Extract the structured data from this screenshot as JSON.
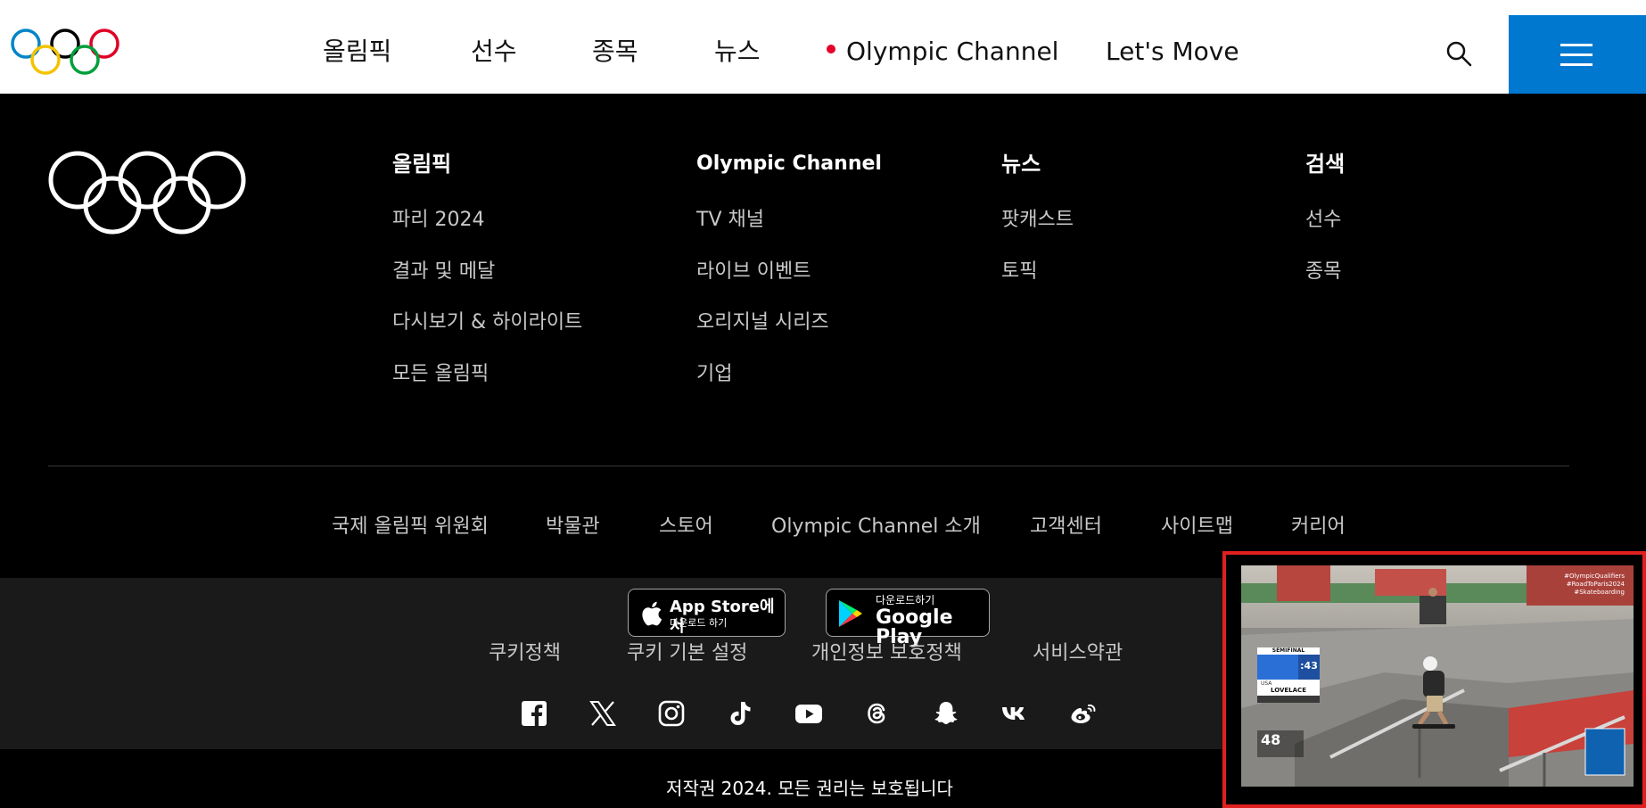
{
  "header": {
    "nav": [
      {
        "label": "올림픽"
      },
      {
        "label": "선수"
      },
      {
        "label": "종목"
      },
      {
        "label": "뉴스"
      },
      {
        "label": "Olympic Channel",
        "live": true
      },
      {
        "label": "Let's Move"
      }
    ],
    "search_icon": "search-icon",
    "menu_icon": "hamburger-menu-icon"
  },
  "footer": {
    "columns": [
      {
        "title": "올림픽",
        "links": [
          "파리 2024",
          "결과 및 메달",
          "다시보기 & 하이라이트",
          "모든 올림픽"
        ]
      },
      {
        "title": "Olympic Channel",
        "links": [
          "TV 채널",
          "라이브 이벤트",
          "오리지널 시리즈",
          "기업"
        ]
      },
      {
        "title": "뉴스",
        "links": [
          "팟캐스트",
          "토픽"
        ]
      },
      {
        "title": "검색",
        "links": [
          "선수",
          "종목"
        ]
      }
    ],
    "bottom_links": [
      "국제 올림픽 위원회",
      "박물관",
      "스토어",
      "Olympic Channel 소개",
      "고객센터",
      "사이트맵",
      "커리어"
    ],
    "app_store": {
      "line1": "App Store에서",
      "line2": "다운로드 하기"
    },
    "google_play": {
      "line1": "다운로드하기",
      "line2": "Google Play"
    },
    "legal_links": [
      "쿠키정책",
      "쿠키 기본 설정",
      "개인정보 보호정책",
      "서비스약관"
    ],
    "social_icons": [
      "facebook-icon",
      "x-icon",
      "instagram-icon",
      "tiktok-icon",
      "youtube-icon",
      "threads-icon",
      "snapchat-icon",
      "vk-icon",
      "weibo-icon"
    ],
    "copyright": "저작권 2024. 모든 권리는 보호됩니다"
  },
  "video": {
    "scoreboard_round": "SEMIFINAL",
    "scoreboard_time": ":43",
    "athlete_country": "USA",
    "athlete_name": "LOVELACE",
    "corner_text": "48",
    "hashtags": [
      "#OlympicQualifiers",
      "#RoadToParis2024",
      "#Skateboarding"
    ]
  },
  "colors": {
    "accent_blue": "#0078d0",
    "live_red": "#e4002b",
    "highlight_border": "#e02020"
  }
}
